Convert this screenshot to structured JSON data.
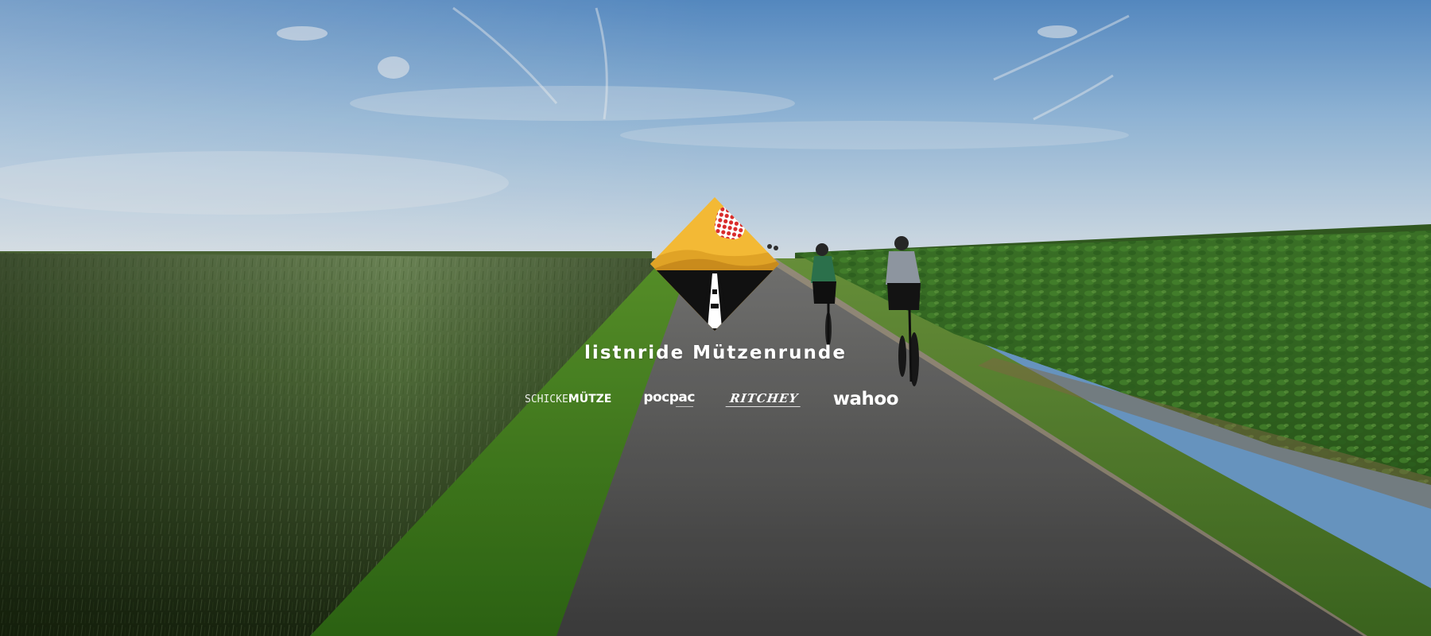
{
  "hero": {
    "title": "listnride Mützenrunde",
    "logo_icon": "road-mountain-diamond-icon",
    "colors": {
      "logo_yellow": "#f3b935",
      "logo_dune": "#d9971f",
      "logo_dots": "#d92b2b",
      "logo_road": "#111111",
      "text": "#ffffff"
    }
  },
  "sponsors": {
    "schicke_part1": "SCHICKE",
    "schicke_part2": "MÜTZE",
    "pocpac": "pocpac",
    "ritchey": "RITCHEY",
    "wahoo": "wahoo"
  }
}
